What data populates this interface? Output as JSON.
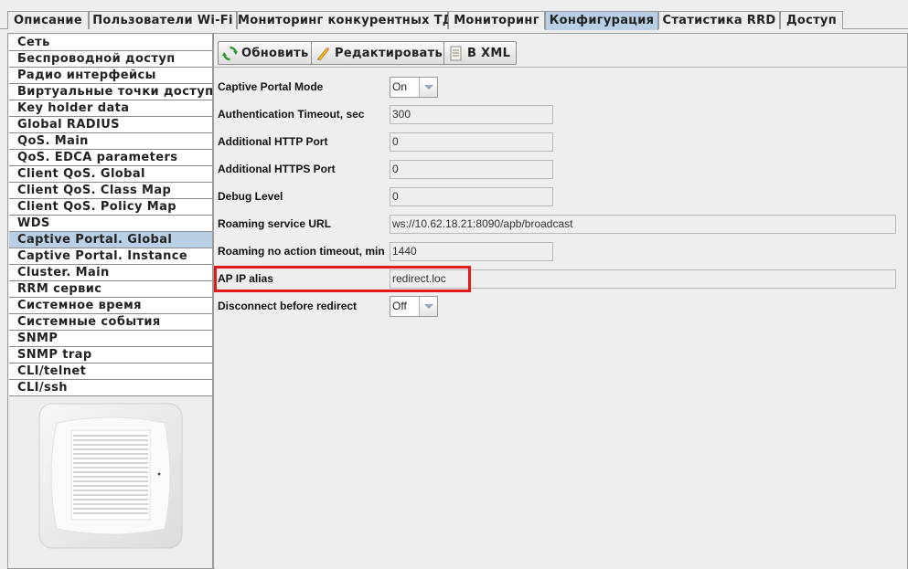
{
  "tabs": [
    {
      "label": "Описание",
      "active": false
    },
    {
      "label": "Пользователи Wi-Fi",
      "active": false
    },
    {
      "label": "Мониторинг конкурентных ТД",
      "active": false
    },
    {
      "label": "Мониторинг",
      "active": false
    },
    {
      "label": "Конфигурация",
      "active": true
    },
    {
      "label": "Статистика RRD",
      "active": false
    },
    {
      "label": "Доступ",
      "active": false
    }
  ],
  "sidebar": {
    "selected": "Captive Portal. Global",
    "items": [
      "Сеть",
      "Беспроводной доступ",
      "Радио интерфейсы",
      "Виртуальные точки доступа",
      "Key holder data",
      "Global RADIUS",
      "QoS. Main",
      "QoS. EDCA parameters",
      "Client QoS. Global",
      "Client QoS. Class Map",
      "Client QoS. Policy Map",
      "WDS",
      "Captive Portal. Global",
      "Captive Portal. Instance",
      "Cluster. Main",
      "RRM сервис",
      "Системное время",
      "Системные события",
      "SNMP",
      "SNMP trap",
      "CLI/telnet",
      "CLI/ssh"
    ]
  },
  "toolbar": {
    "refresh_label": "Обновить",
    "edit_label": "Редактировать",
    "xml_label": "В XML"
  },
  "form": {
    "captive_portal_mode": {
      "label": "Captive Portal Mode",
      "value": "On"
    },
    "auth_timeout": {
      "label": "Authentication Timeout, sec",
      "value": "300"
    },
    "http_port": {
      "label": "Additional HTTP Port",
      "value": "0"
    },
    "https_port": {
      "label": "Additional HTTPS Port",
      "value": "0"
    },
    "debug_level": {
      "label": "Debug Level",
      "value": "0"
    },
    "roaming_url": {
      "label": "Roaming service URL",
      "value": "ws://10.62.18.21:8090/apb/broadcast"
    },
    "roaming_timeout": {
      "label": "Roaming no action timeout, min",
      "value": "1440"
    },
    "ap_ip_alias": {
      "label": "AP IP alias",
      "value": "redirect.loc"
    },
    "disconnect_before_redirect": {
      "label": "Disconnect before redirect",
      "value": "Off"
    }
  },
  "colors": {
    "selection": "#b8cfe5",
    "highlight_border": "#e11b1b"
  },
  "icons": {
    "refresh": "refresh-icon",
    "edit": "pencil-icon",
    "xml": "document-icon"
  }
}
